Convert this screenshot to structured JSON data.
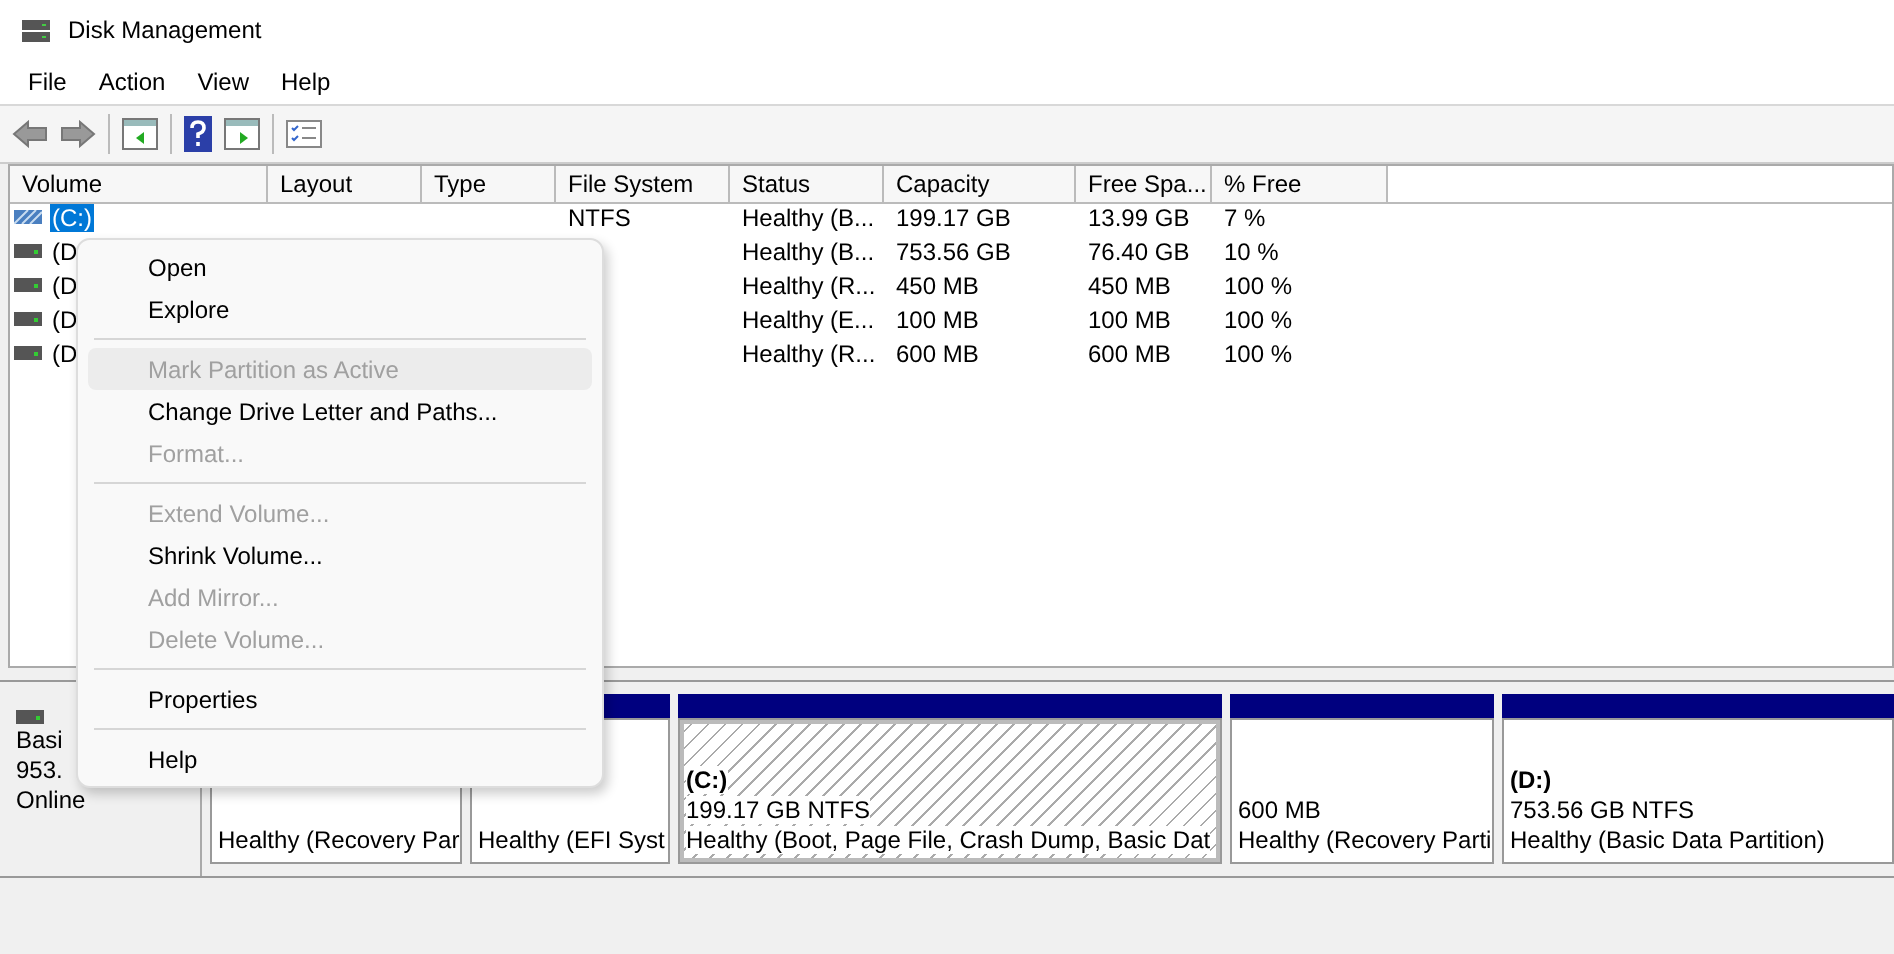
{
  "window": {
    "title": "Disk Management"
  },
  "menu_bar": [
    "File",
    "Action",
    "View",
    "Help"
  ],
  "table": {
    "columns": [
      "Volume",
      "Layout",
      "Type",
      "File System",
      "Status",
      "Capacity",
      "Free Spa...",
      "% Free"
    ],
    "rows": [
      {
        "selected": true,
        "kind": "striped",
        "cells": [
          "(C:)",
          null,
          null,
          "NTFS",
          "Healthy (B...",
          "199.17 GB",
          "13.99 GB",
          "7 %"
        ]
      },
      {
        "selected": false,
        "kind": "drive",
        "cells": [
          "(D",
          null,
          null,
          null,
          "Healthy (B...",
          "753.56 GB",
          "76.40 GB",
          "10 %"
        ]
      },
      {
        "selected": false,
        "kind": "drive",
        "cells": [
          "(D",
          null,
          null,
          null,
          "Healthy (R...",
          "450 MB",
          "450 MB",
          "100 %"
        ]
      },
      {
        "selected": false,
        "kind": "drive",
        "cells": [
          "(D",
          null,
          null,
          null,
          "Healthy (E...",
          "100 MB",
          "100 MB",
          "100 %"
        ]
      },
      {
        "selected": false,
        "kind": "drive",
        "cells": [
          "(D",
          null,
          null,
          null,
          "Healthy (R...",
          "600 MB",
          "600 MB",
          "100 %"
        ]
      }
    ]
  },
  "disk": {
    "lines": [
      "Basi",
      "953.",
      "Online"
    ],
    "partitions": [
      {
        "hatched": false,
        "lines": [
          "Healthy (Recovery Par"
        ]
      },
      {
        "hatched": false,
        "lines": [
          "Healthy (EFI Syst"
        ]
      },
      {
        "hatched": true,
        "name": "(C:)",
        "lines": [
          "199.17 GB NTFS",
          "Healthy (Boot, Page File, Crash Dump, Basic Dat"
        ]
      },
      {
        "hatched": false,
        "lines": [
          "600 MB",
          "Healthy (Recovery Parti"
        ]
      },
      {
        "hatched": false,
        "name": "(D:)",
        "lines": [
          "753.56 GB NTFS",
          "Healthy (Basic Data Partition)"
        ]
      }
    ]
  },
  "context_menu": [
    {
      "kind": "item",
      "label": "Open",
      "disabled": false,
      "selected": false
    },
    {
      "kind": "item",
      "label": "Explore",
      "disabled": false,
      "selected": false
    },
    {
      "kind": "separator"
    },
    {
      "kind": "item",
      "label": "Mark Partition as Active",
      "disabled": true,
      "selected": true
    },
    {
      "kind": "item",
      "label": "Change Drive Letter and Paths...",
      "disabled": false,
      "selected": false
    },
    {
      "kind": "item",
      "label": "Format...",
      "disabled": true,
      "selected": false
    },
    {
      "kind": "separator"
    },
    {
      "kind": "item",
      "label": "Extend Volume...",
      "disabled": true,
      "selected": false
    },
    {
      "kind": "item",
      "label": "Shrink Volume...",
      "disabled": false,
      "selected": false
    },
    {
      "kind": "item",
      "label": "Add Mirror...",
      "disabled": true,
      "selected": false
    },
    {
      "kind": "item",
      "label": "Delete Volume...",
      "disabled": true,
      "selected": false
    },
    {
      "kind": "separator"
    },
    {
      "kind": "item",
      "label": "Properties",
      "disabled": false,
      "selected": false
    },
    {
      "kind": "separator"
    },
    {
      "kind": "item",
      "label": "Help",
      "disabled": false,
      "selected": false
    }
  ]
}
